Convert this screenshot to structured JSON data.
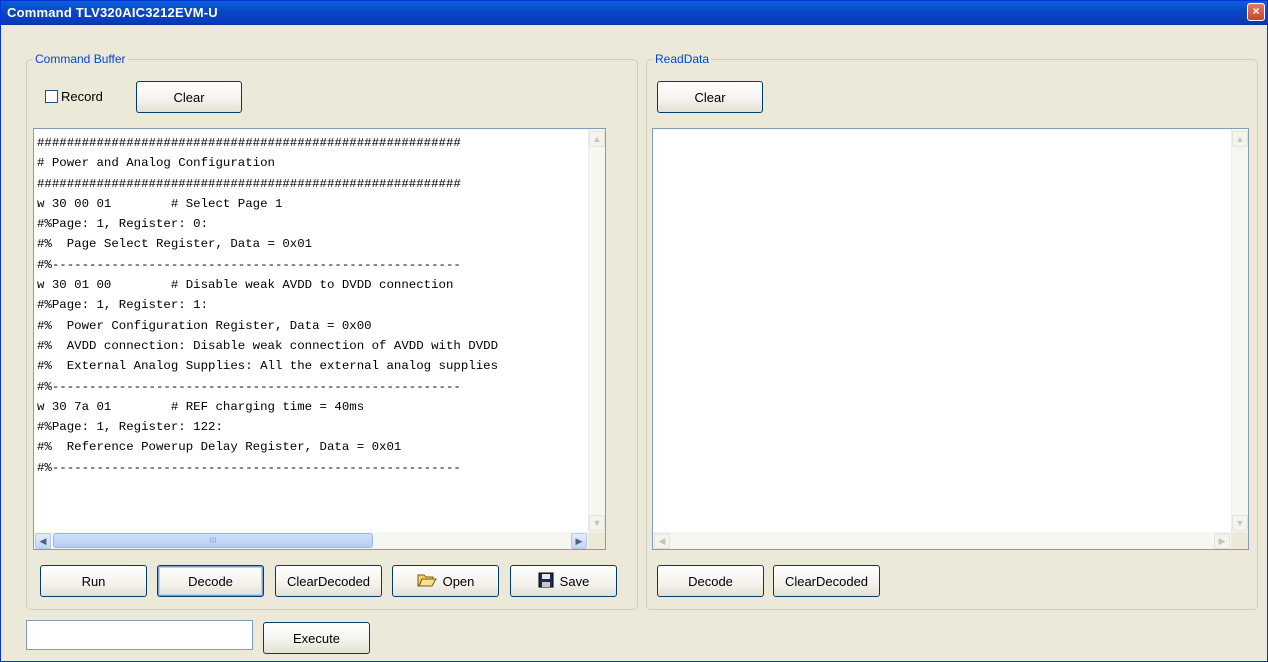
{
  "window": {
    "title": "Command TLV320AIC3212EVM-U",
    "close_label": "×"
  },
  "command_buffer": {
    "legend": "Command Buffer",
    "record_label": "Record",
    "record_checked": false,
    "clear_label": "Clear",
    "content": "#########################################################\n# Power and Analog Configuration\n#########################################################\nw 30 00 01        # Select Page 1\n#%Page: 1, Register: 0:\n#%  Page Select Register, Data = 0x01\n#%-------------------------------------------------------\nw 30 01 00        # Disable weak AVDD to DVDD connection\n#%Page: 1, Register: 1:\n#%  Power Configuration Register, Data = 0x00\n#%  AVDD connection: Disable weak connection of AVDD with DVDD\n#%  External Analog Supplies: All the external analog supplies\n#%-------------------------------------------------------\nw 30 7a 01        # REF charging time = 40ms\n#%Page: 1, Register: 122:\n#%  Reference Powerup Delay Register, Data = 0x01\n#%-------------------------------------------------------",
    "scroll_grip": "III",
    "buttons": {
      "run": "Run",
      "decode": "Decode",
      "clear_decoded": "ClearDecoded",
      "open": "Open",
      "save": "Save"
    }
  },
  "read_data": {
    "legend": "ReadData",
    "clear_label": "Clear",
    "content": "",
    "buttons": {
      "decode": "Decode",
      "clear_decoded": "ClearDecoded"
    }
  },
  "execute": {
    "input_value": "",
    "button_label": "Execute"
  },
  "icons": {
    "scroll_up": "▲",
    "scroll_down": "▼",
    "scroll_left": "◀",
    "scroll_right": "▶"
  }
}
